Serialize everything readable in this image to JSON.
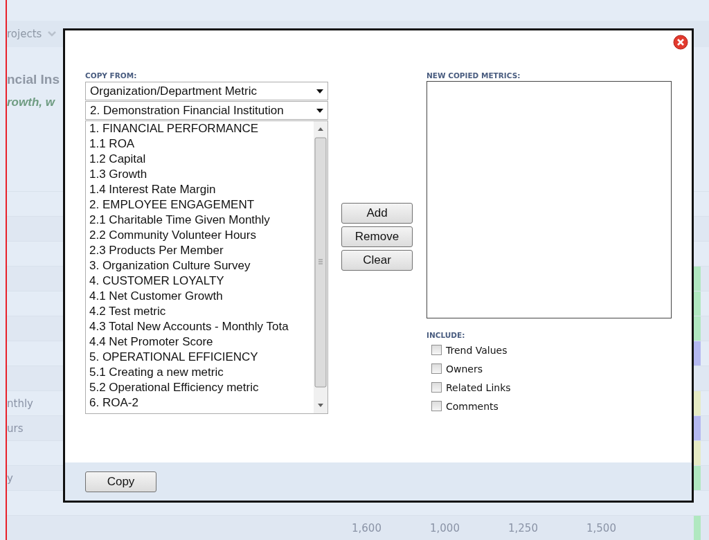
{
  "background": {
    "breadcrumb": "rojects",
    "title": "ncial Ins",
    "subtitle": "rowth, w",
    "rows": [
      {},
      {},
      {},
      {
        "color": "#b0e8c0"
      },
      {
        "color": "#b0e8c0"
      },
      {
        "color": "#b0e8c0"
      },
      {
        "color": "#b4b8f0"
      },
      {},
      {
        "label": "nthly",
        "color": "#e6ebc4"
      },
      {
        "label": "urs",
        "color": "#b4b8f0"
      },
      {
        "color": "#e6ebc4"
      },
      {
        "label": "y",
        "color": "#b0e8c0"
      },
      {},
      {
        "color": "#b0e8c0",
        "cells": [
          "1,600",
          "1,000",
          "1,250",
          "1,500"
        ]
      }
    ]
  },
  "dialog": {
    "copy_from": {
      "label": "COPY FROM:",
      "dropdowns": [
        "Organization/Department Metric",
        "2.  Demonstration Financial Institution"
      ],
      "list": [
        "1.  FINANCIAL PERFORMANCE",
        "1.1  ROA",
        "1.2  Capital",
        "1.3  Growth",
        "1.4  Interest Rate Margin",
        "2.  EMPLOYEE ENGAGEMENT",
        "2.1  Charitable Time Given Monthly",
        "2.2  Community Volunteer Hours",
        "2.3  Products Per Member",
        "3.  Organization Culture Survey",
        "4.  CUSTOMER LOYALTY",
        "4.1  Net Customer Growth",
        "4.2  Test metric",
        "4.3  Total New Accounts - Monthly Tota",
        "4.4  Net Promoter Score",
        "5.  OPERATIONAL EFFICIENCY",
        "5.1  Creating a new metric",
        "5.2  Operational Efficiency metric",
        "6.  ROA-2"
      ]
    },
    "buttons": [
      "Add",
      "Remove",
      "Clear"
    ],
    "new_copied": {
      "label": "NEW COPIED METRICS:"
    },
    "include": {
      "label": "INCLUDE:",
      "options": [
        {
          "label": "Trend Values",
          "checked": false
        },
        {
          "label": "Owners",
          "checked": false
        },
        {
          "label": "Related Links",
          "checked": false
        },
        {
          "label": "Comments",
          "checked": false
        }
      ]
    },
    "footer_button": "Copy"
  }
}
